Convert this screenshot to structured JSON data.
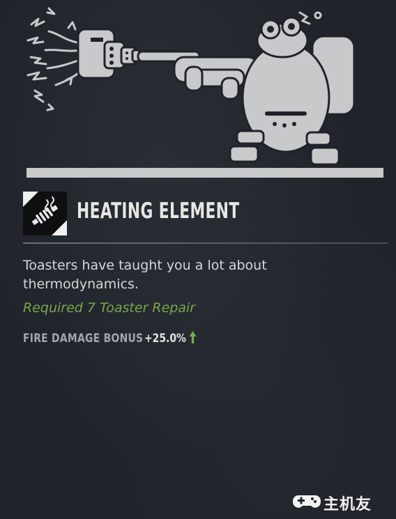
{
  "perk": {
    "title": "HEATING ELEMENT",
    "description": "Toasters have taught you a lot about thermodynamics.",
    "requirement": "Required 7 Toaster Repair",
    "stat": {
      "label": "FIRE DAMAGE BONUS",
      "value": "+25.0%",
      "direction": "up"
    },
    "icon": "heating-coil-icon"
  },
  "illustration": {
    "subject": "robot-with-flamethrower-illustration"
  },
  "watermark": {
    "text": "主机友",
    "icon": "gamepad-logo-icon"
  },
  "colors": {
    "background": "#1f2329",
    "accent_green": "#7aa64a",
    "title": "#e6e6e4",
    "text": "#d6d7d8",
    "stat_label": "#a4a6aa"
  }
}
